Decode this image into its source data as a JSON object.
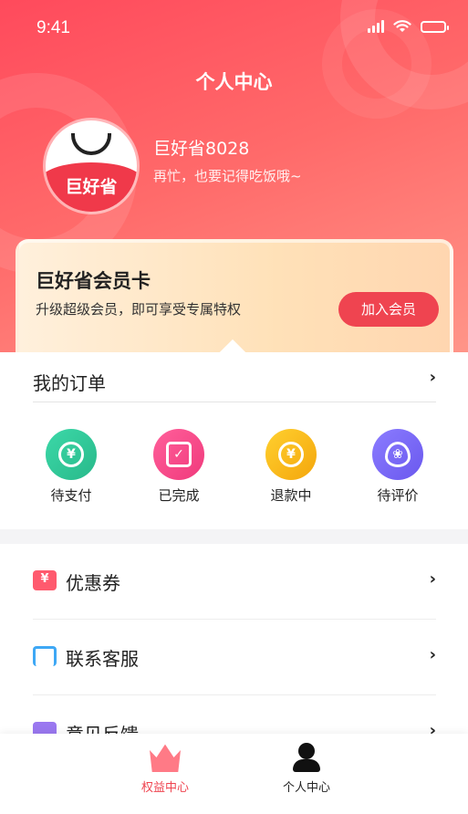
{
  "status_bar": {
    "time": "9:41",
    "battery_level": 1.0
  },
  "header": {
    "title": "个人中心"
  },
  "profile": {
    "avatar_text": "巨好省",
    "name": "巨好省8028",
    "motto": "再忙，也要记得吃饭哦~"
  },
  "member_card": {
    "title": "巨好省会员卡",
    "description": "升级超级会员，即可享受专属特权",
    "join_label": "加入会员"
  },
  "orders": {
    "title": "我的订单",
    "statuses": [
      {
        "label": "待支付",
        "icon": "yuan-coin-icon",
        "glyph": "¥"
      },
      {
        "label": "已完成",
        "icon": "clipboard-check-icon",
        "glyph": "✓"
      },
      {
        "label": "退款中",
        "icon": "refund-icon",
        "glyph": "¥"
      },
      {
        "label": "待评价",
        "icon": "flower-icon",
        "glyph": "❀"
      }
    ]
  },
  "menu": {
    "items": [
      {
        "label": "优惠券",
        "icon": "coupon-icon"
      },
      {
        "label": "联系客服",
        "icon": "headset-icon"
      },
      {
        "label": "意见反馈",
        "icon": "chat-bubble-icon"
      }
    ]
  },
  "tabbar": {
    "tabs": [
      {
        "label": "权益中心",
        "icon": "crown-icon",
        "active": true
      },
      {
        "label": "个人中心",
        "icon": "person-icon",
        "active": false
      }
    ]
  },
  "colors": {
    "accent": "#ef4450",
    "hero_start": "#ff4a5c",
    "hero_end": "#ff9a8c",
    "member_card": "#ffe1b8"
  }
}
